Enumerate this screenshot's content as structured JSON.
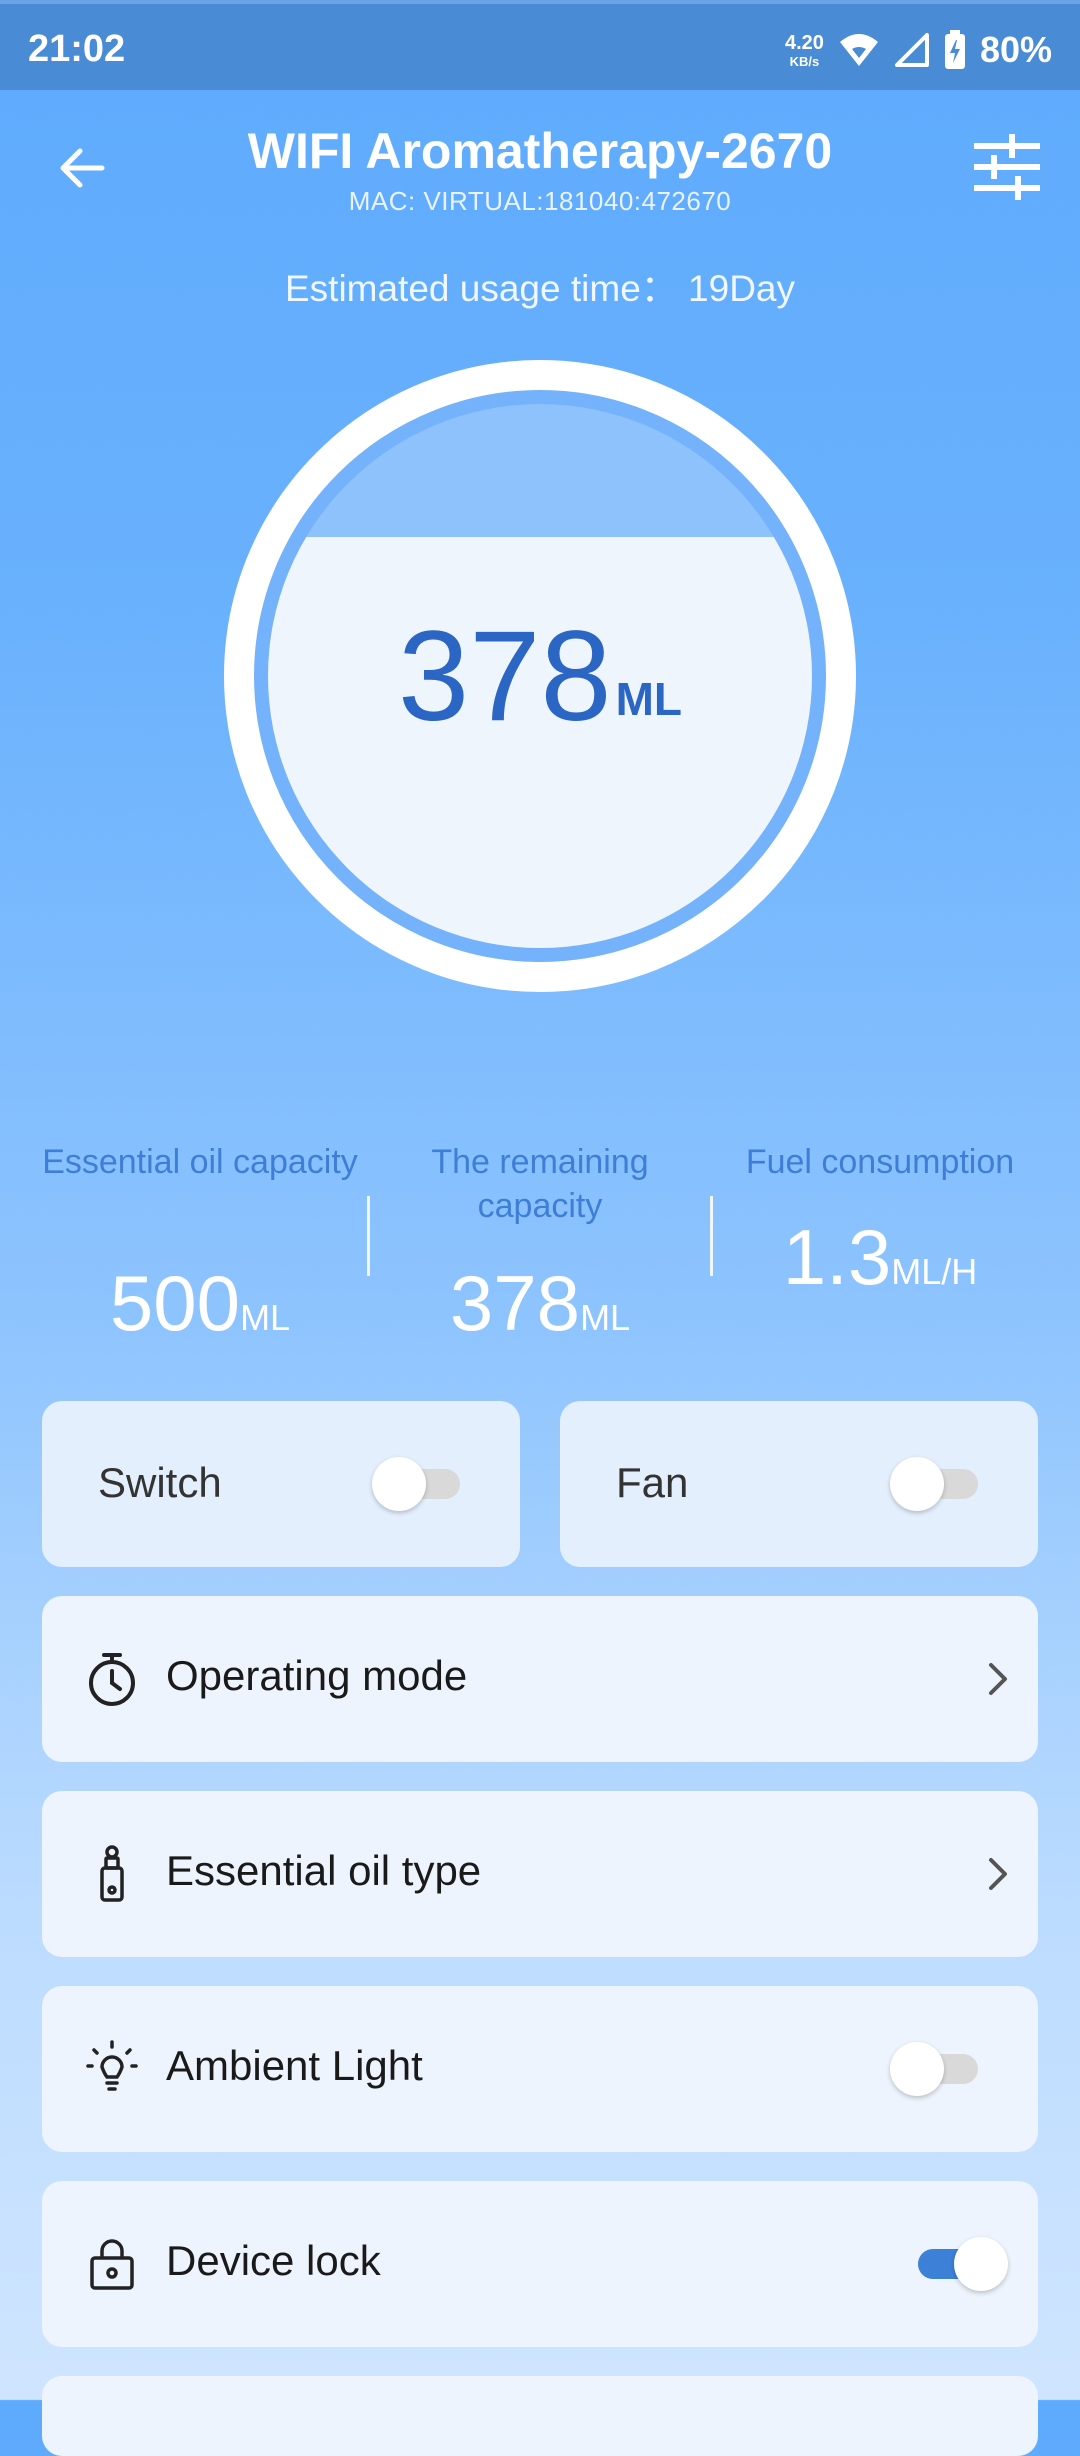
{
  "status_bar": {
    "time": "21:02",
    "net_speed": "4.20",
    "net_unit": "KB/s",
    "battery": "80%"
  },
  "header": {
    "title": "WIFI Aromatherapy-2670",
    "mac": "MAC: VIRTUAL:181040:472670",
    "estimated_usage": "Estimated usage time： 19Day"
  },
  "gauge": {
    "value": "378",
    "unit": "ML",
    "fill_fraction": 0.756
  },
  "stats": [
    {
      "label": "Essential oil capacity",
      "value": "500",
      "unit": "ML"
    },
    {
      "label": "The remaining capacity",
      "value": "378",
      "unit": "ML"
    },
    {
      "label": "Fuel consumption",
      "value": "1.3",
      "unit": "ML/H"
    }
  ],
  "tiles": {
    "switch": {
      "label": "Switch",
      "on": false
    },
    "fan": {
      "label": "Fan",
      "on": false
    }
  },
  "rows": {
    "operating_mode": {
      "label": "Operating mode",
      "icon": "timer-icon"
    },
    "oil_type": {
      "label": "Essential oil type",
      "icon": "oil-bottle-icon"
    },
    "ambient_light": {
      "label": "Ambient Light",
      "icon": "lightbulb-icon",
      "on": false
    },
    "device_lock": {
      "label": "Device lock",
      "icon": "lock-icon",
      "on": true
    }
  },
  "colors": {
    "accent": "#3d80d8",
    "gauge_text": "#2b66c4",
    "stat_label": "#3f7ed6"
  }
}
